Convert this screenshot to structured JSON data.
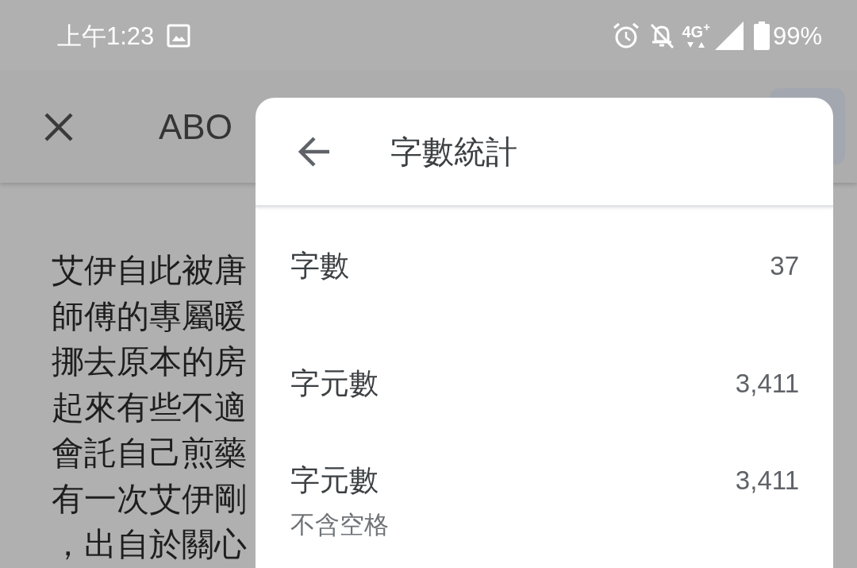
{
  "status_bar": {
    "time": "上午1:23",
    "network": "4G$^{+}$",
    "battery": "99%"
  },
  "app_bar": {
    "title": "ABO"
  },
  "document": {
    "lines": [
      "艾伊自此被唐",
      "師傅的專屬暖",
      "挪去原本的房",
      "起來有些不適",
      "會託自己煎藥",
      "有一次艾伊剛",
      "，出自於關心"
    ]
  },
  "dialog": {
    "title": "字數統計",
    "stats": [
      {
        "label": "字數",
        "value": "37"
      },
      {
        "label": "字元數",
        "value": "3,411"
      },
      {
        "label": "字元數",
        "sublabel": "不含空格",
        "value": "3,411"
      }
    ]
  }
}
